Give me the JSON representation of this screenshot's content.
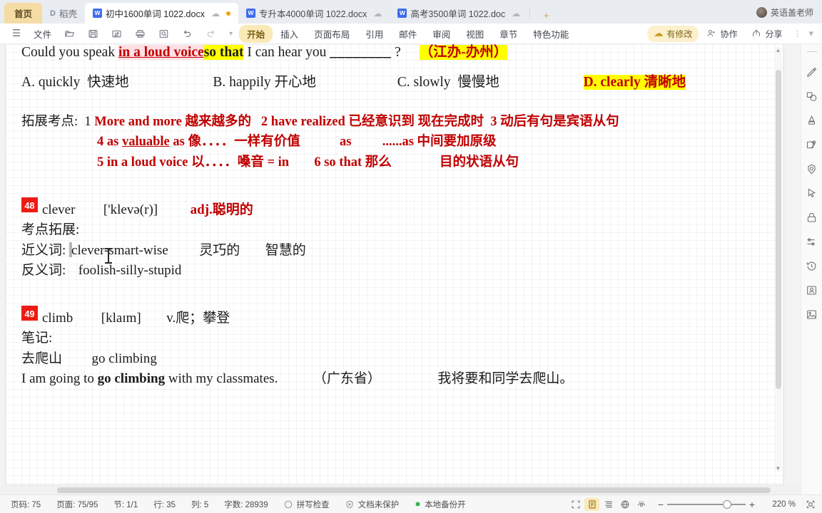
{
  "tabbar": {
    "home_label": "首页",
    "docer_label": "稻壳",
    "docer_icon": "docer-icon",
    "tabs": [
      {
        "label": "初中1600单词 1022.docx",
        "icon": "wps-writer-icon",
        "cloud": "cloud-icon",
        "active": true,
        "modified": true
      },
      {
        "label": "专升本4000单词 1022.docx",
        "icon": "wps-writer-icon",
        "cloud": "cloud-icon",
        "active": false,
        "modified": false
      },
      {
        "label": "高考3500单词 1022.doc",
        "icon": "wps-writer-icon",
        "cloud": "cloud-icon",
        "active": false,
        "modified": false
      }
    ],
    "new_tab": "+",
    "user_name": "英语盖老师"
  },
  "ribbon": {
    "menu_icon": "hamburger-icon",
    "file_label": "文件",
    "quick_icons": [
      "open-folder-icon",
      "save-icon",
      "save-as-icon",
      "print-icon",
      "print-preview-icon",
      "undo-icon",
      "redo-icon",
      "customize-dropdown-icon"
    ],
    "tabs": [
      {
        "label": "开始",
        "selected": true
      },
      {
        "label": "插入",
        "selected": false
      },
      {
        "label": "页面布局",
        "selected": false
      },
      {
        "label": "引用",
        "selected": false
      },
      {
        "label": "邮件",
        "selected": false
      },
      {
        "label": "审阅",
        "selected": false
      },
      {
        "label": "视图",
        "selected": false
      },
      {
        "label": "章节",
        "selected": false
      },
      {
        "label": "特色功能",
        "selected": false
      }
    ],
    "right": {
      "modified_label": "有修改",
      "modified_icon": "cloud-edit-icon",
      "collab_label": "协作",
      "collab_icon": "collaborate-icon",
      "share_label": "分享",
      "share_icon": "share-icon",
      "more_icon": "more-vertical-icon",
      "collapse_icon": "chevron-down-icon"
    }
  },
  "document": {
    "question": {
      "prefix": "Could you speak ",
      "phrase_pink": "in a loud voice",
      "phrase_yellow": "so that",
      "middle": " I can hear you ",
      "blank": "________",
      "qmark": " ?",
      "source_tag": "（江办-办州）"
    },
    "options": [
      {
        "letter": "A.",
        "word": "quickly",
        "cn": "快速地",
        "highlight": false
      },
      {
        "letter": "B.",
        "word": "happily",
        "cn": "开心地",
        "highlight": false
      },
      {
        "letter": "C.",
        "word": "slowly",
        "cn": "慢慢地",
        "highlight": false
      },
      {
        "letter": "D.",
        "word": "clearly",
        "cn": "清晰地",
        "highlight": true
      }
    ],
    "extension": {
      "label": "拓展考点:",
      "line1": [
        {
          "num": "1",
          "en": "More and more",
          "cn": "越来越多的"
        },
        {
          "num": "2",
          "en": "have realized",
          "cn": "已经意识到  现在完成时"
        },
        {
          "num": "3",
          "en": "",
          "cn": "动后有句是宾语从句"
        }
      ],
      "line2_num": "4",
      "line2_a": "as ",
      "line2_under": "valuable",
      "line2_b": " as 像．．．．一样有价值",
      "line2_tail1": "as",
      "line2_tail2": "......as 中间要加原级",
      "line3_num": "5",
      "line3_en": "in a loud voice",
      "line3_cn": "以．．．．嗓音  =  in",
      "line3_num2": "6",
      "line3_en2": "so that",
      "line3_cn2": "那么",
      "line3_tail": "目的状语从句"
    },
    "entries": [
      {
        "number": "48",
        "word": "clever",
        "phonetic": "['klevə(r)]",
        "pos": "adj.聪明的",
        "sub_label": "考点拓展:",
        "rows": [
          {
            "label": "近义词:",
            "value": "clever-smart-wise",
            "extra1": "灵巧的",
            "extra2": "智慧的"
          },
          {
            "label": "反义词:",
            "value": "foolish-silly-stupid",
            "extra1": "",
            "extra2": ""
          }
        ]
      },
      {
        "number": "49",
        "word": "climb",
        "phonetic": "[klaɪm]",
        "pos": "v.爬；攀登",
        "sub_label": "笔记:",
        "rows": [
          {
            "label": "去爬山",
            "value": "go climbing",
            "extra1": "",
            "extra2": ""
          }
        ],
        "example": {
          "pre": "I am going to ",
          "bold": "go climbing",
          "post": " with my classmates.",
          "source": "（广东省）",
          "translation": "我将要和同学去爬山。"
        }
      }
    ]
  },
  "rail": {
    "icons": [
      "highlighter-pen-icon",
      "shapes-icon",
      "ink-pen-icon",
      "stamp-annotate-icon",
      "badge-seal-icon",
      "select-cursor-icon",
      "lock-icon",
      "sliders-settings-icon",
      "history-clock-icon",
      "person-photo-icon",
      "picture-icon"
    ]
  },
  "status": {
    "page_label": "页码: 75",
    "pages_label": "页面: 75/95",
    "section_label": "节: 1/1",
    "row_label": "行: 35",
    "col_label": "列: 5",
    "words_label": "字数: 28939",
    "spellcheck_label": "拼写检查",
    "spellcheck_icon": "spellcheck-icon",
    "protect_label": "文档未保护",
    "protect_icon": "unprotected-icon",
    "backup_label": "本地备份开",
    "backup_icon": "backup-on-icon",
    "views": [
      {
        "icon": "fullscreen-icon",
        "active": false
      },
      {
        "icon": "page-view-icon",
        "active": true
      },
      {
        "icon": "outline-view-icon",
        "active": false
      },
      {
        "icon": "web-view-icon",
        "active": false
      },
      {
        "icon": "eye-reading-icon",
        "active": false
      }
    ],
    "zoom_out": "−",
    "zoom_in": "+",
    "zoom_value": "220 %",
    "fit_icon": "fit-page-icon"
  },
  "colors": {
    "accent_yellow": "#fbe9b7",
    "brand_blue": "#3c6df0",
    "doc_red": "#c00000",
    "badge_red": "#ee1b14",
    "highlight_yellow": "#ffff00",
    "highlight_pink": "#fde0e4"
  }
}
